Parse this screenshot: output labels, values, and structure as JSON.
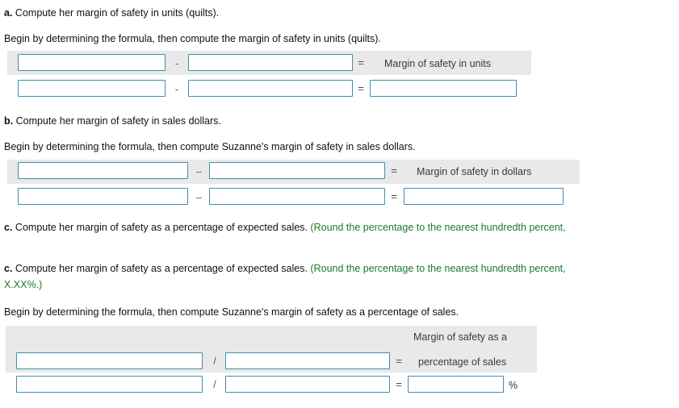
{
  "part_a": {
    "question": "Compute her margin of safety in units (quilts).",
    "lead": "a.",
    "instruction": "Begin by determining the formula, then compute the margin of safety in units (quilts).",
    "operator1": "-",
    "operator2": "=",
    "result_label": "Margin of safety in units",
    "inputs": {
      "r1c1": "",
      "r1c2": "",
      "r2c1": "",
      "r2c2": "",
      "r2c3": ""
    }
  },
  "part_b": {
    "question": "Compute her margin of safety in sales dollars.",
    "lead": "b.",
    "instruction": "Begin by determining the formula, then compute Suzanne's margin of safety in sales dollars.",
    "operator1": "–",
    "operator2": "=",
    "result_label": "Margin of safety in dollars",
    "inputs": {
      "r1c1": "",
      "r1c2": "",
      "r2c1": "",
      "r2c2": "",
      "r2c3": ""
    }
  },
  "part_c": {
    "lead": "c.",
    "question_black": "Compute her margin of safety as a percentage of expected sales.",
    "question_green_partial": "(Round the percentage to the nearest hundredth percent,",
    "question_green_full": "(Round the percentage to the nearest hundredth percent, X.XX%.)",
    "question_green_line1": "(Round the percentage to the nearest hundredth percent,",
    "question_green_line2": "X.XX%.)",
    "instruction": "Begin by determining the formula, then compute Suzanne's margin of safety as a percentage of sales.",
    "operator1": "/",
    "operator2": "=",
    "result_label_line1": "Margin of safety as a",
    "result_label_line2": "percentage of sales",
    "percent_sign": "%",
    "inputs": {
      "r1c1": "",
      "r1c2": "",
      "r2c1": "",
      "r2c2": "",
      "r2c3": ""
    }
  },
  "colors": {
    "band": "#e9e9e9",
    "input_border": "#3f8fab",
    "green_text": "#1c7a2a",
    "body_text": "#111111",
    "label_text": "#3a3a3a"
  }
}
